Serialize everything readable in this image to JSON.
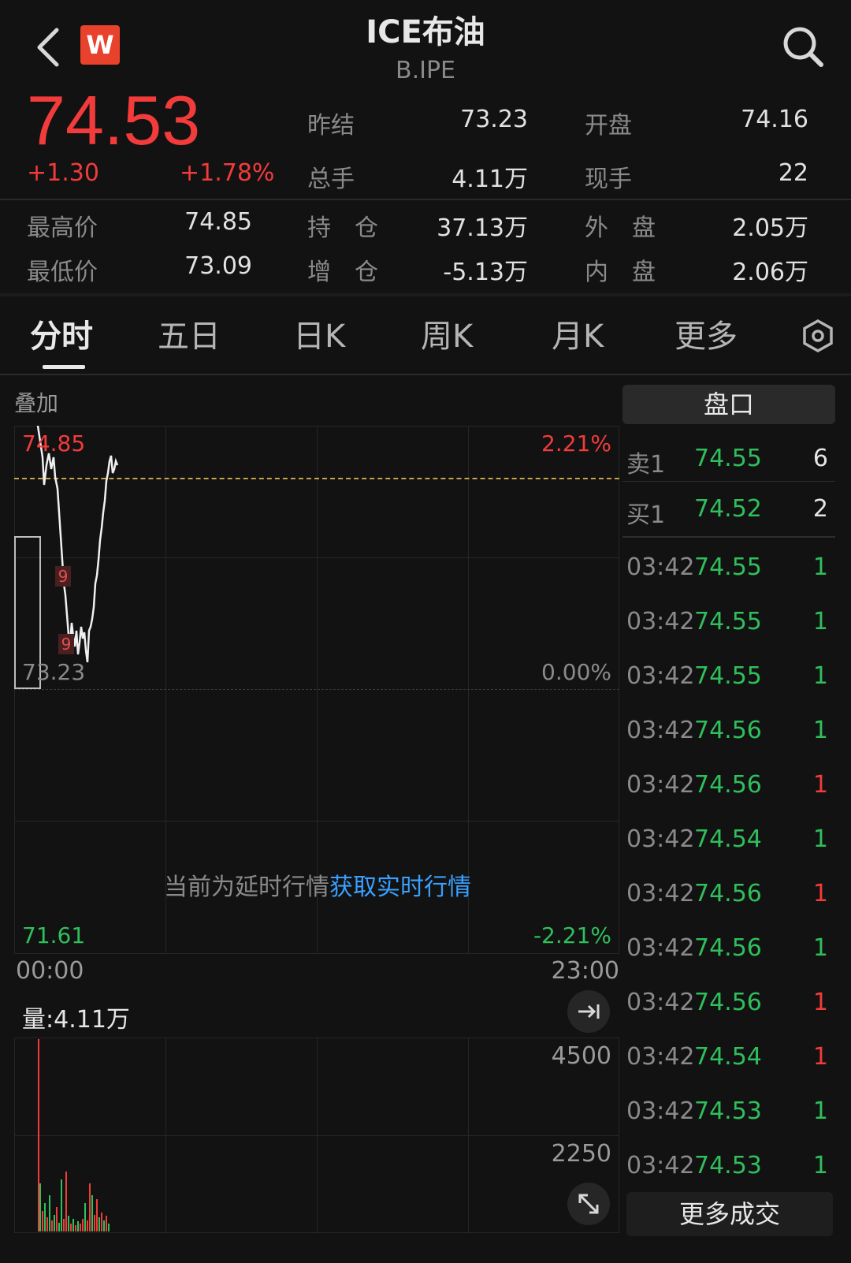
{
  "header": {
    "title": "ICE布油",
    "subtitle": "B.IPE",
    "logo_letter": "W"
  },
  "quote": {
    "price": "74.53",
    "change": "+1.30",
    "change_pct": "+1.78%",
    "stats": [
      {
        "label": "昨结",
        "value": "73.23"
      },
      {
        "label": "开盘",
        "value": "74.16"
      },
      {
        "label": "总手",
        "value": "4.11万"
      },
      {
        "label": "现手",
        "value": "22"
      },
      {
        "label": "最高价",
        "value": "74.85"
      },
      {
        "label": "持　仓",
        "value": "37.13万"
      },
      {
        "label": "外　盘",
        "value": "2.05万"
      },
      {
        "label": "最低价",
        "value": "73.09"
      },
      {
        "label": "增　仓",
        "value": "-5.13万"
      },
      {
        "label": "内　盘",
        "value": "2.06万"
      }
    ]
  },
  "tabs": [
    "分时",
    "五日",
    "日K",
    "周K",
    "月K",
    "更多"
  ],
  "chart": {
    "overlay_label": "叠加",
    "y_top": "74.85",
    "y_mid": "73.23",
    "y_bottom": "71.61",
    "pct_top": "2.21%",
    "pct_mid": "0.00%",
    "pct_bottom": "-2.21%",
    "x_start": "00:00",
    "x_end": "23:00",
    "delay_notice": "当前为延时行情",
    "delay_link": "获取实时行情",
    "marker": "9",
    "volume_label": "量:4.11万",
    "vol_top": "4500",
    "vol_mid": "2250"
  },
  "order_book": {
    "title": "盘口",
    "asks": [
      {
        "label": "卖1",
        "price": "74.55",
        "qty": "6"
      }
    ],
    "bids": [
      {
        "label": "买1",
        "price": "74.52",
        "qty": "2"
      }
    ]
  },
  "trades": [
    {
      "time": "03:42",
      "price": "74.55",
      "qty": "1",
      "dir": "green"
    },
    {
      "time": "03:42",
      "price": "74.55",
      "qty": "1",
      "dir": "green"
    },
    {
      "time": "03:42",
      "price": "74.55",
      "qty": "1",
      "dir": "green"
    },
    {
      "time": "03:42",
      "price": "74.56",
      "qty": "1",
      "dir": "green"
    },
    {
      "time": "03:42",
      "price": "74.56",
      "qty": "1",
      "dir": "red"
    },
    {
      "time": "03:42",
      "price": "74.54",
      "qty": "1",
      "dir": "green"
    },
    {
      "time": "03:42",
      "price": "74.56",
      "qty": "1",
      "dir": "red"
    },
    {
      "time": "03:42",
      "price": "74.56",
      "qty": "1",
      "dir": "green"
    },
    {
      "time": "03:42",
      "price": "74.56",
      "qty": "1",
      "dir": "red"
    },
    {
      "time": "03:42",
      "price": "74.54",
      "qty": "1",
      "dir": "red"
    },
    {
      "time": "03:42",
      "price": "74.53",
      "qty": "1",
      "dir": "green"
    },
    {
      "time": "03:42",
      "price": "74.53",
      "qty": "1",
      "dir": "green"
    }
  ],
  "more_trades_label": "更多成交",
  "colors": {
    "up": "#f23b3b",
    "down": "#2fbf5c",
    "link": "#3aa0ff",
    "background": "#121212"
  }
}
